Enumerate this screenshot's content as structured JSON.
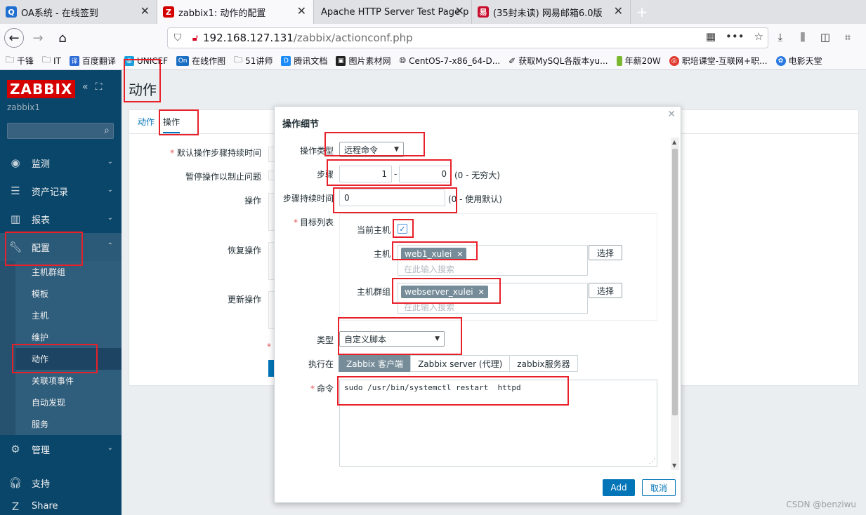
{
  "browser": {
    "tabs": [
      {
        "title": "OA系统 - 在线签到",
        "fav_color": "#1f6fd1",
        "fav_glyph": "Q"
      },
      {
        "title": "zabbix1: 动作的配置",
        "fav_color": "#d40000",
        "fav_glyph": "Z"
      },
      {
        "title": "Apache HTTP Server Test Page p",
        "fav_color": "",
        "fav_glyph": ""
      },
      {
        "title": "(35封未读) 网易邮箱6.0版",
        "fav_color": "#c8102e",
        "fav_glyph": "易"
      }
    ],
    "url_host": "192.168.127.131",
    "url_path": "/zabbix/actionconf.php",
    "bookmarks": [
      "千锋",
      "IT",
      "百度翻译",
      "UNICEF",
      "在线作图",
      "51讲师",
      "腾讯文档",
      "图片素材网",
      "CentOS-7-x86_64-D...",
      "获取MySQL各版本yu...",
      "年薪20W",
      "职培课堂-互联网+职...",
      "电影天堂"
    ]
  },
  "sidebar": {
    "logo": "ZABBIX",
    "server_name": "zabbix1",
    "menu": {
      "monitoring": "监测",
      "inventory": "资产记录",
      "reports": "报表",
      "configuration": "配置",
      "administration": "管理",
      "support": "支持",
      "share": "Share"
    },
    "submenu": [
      "主机群组",
      "模板",
      "主机",
      "维护",
      "动作",
      "关联项事件",
      "自动发现",
      "服务"
    ]
  },
  "page": {
    "title": "动作",
    "tabs": [
      "动作",
      "操作"
    ],
    "labels": {
      "default_step_duration": "默认操作步骤持续时间",
      "pause_ops": "暂停操作以制止问题",
      "operations": "操作",
      "recovery_ops": "恢复操作",
      "update_ops": "更新操作"
    }
  },
  "dialog": {
    "title": "操作细节",
    "op_type_label": "操作类型",
    "op_type_value": "远程命令",
    "steps_label": "步骤",
    "step_from": "1",
    "step_to": "0",
    "steps_hint": "(0 - 无穷大)",
    "step_duration_label": "步骤持续时间",
    "step_duration_value": "0",
    "step_duration_hint": "(0 - 使用默认)",
    "target_list_label": "目标列表",
    "current_host_label": "当前主机",
    "host_label": "主机",
    "host_chip": "web1_xulei",
    "host_group_label": "主机群组",
    "host_group_chip": "webserver_xulei",
    "search_placeholder": "在此输入搜索",
    "select_label": "选择",
    "type_label": "类型",
    "type_value": "自定义脚本",
    "execute_on_label": "执行在",
    "execute_on_options": [
      "Zabbix 客户端",
      "Zabbix server (代理)",
      "zabbix服务器"
    ],
    "command_label": "命令",
    "command_value": "sudo /usr/bin/systemctl restart  httpd",
    "add_label": "Add",
    "cancel_label": "取消"
  },
  "watermark": "CSDN @benziwu"
}
